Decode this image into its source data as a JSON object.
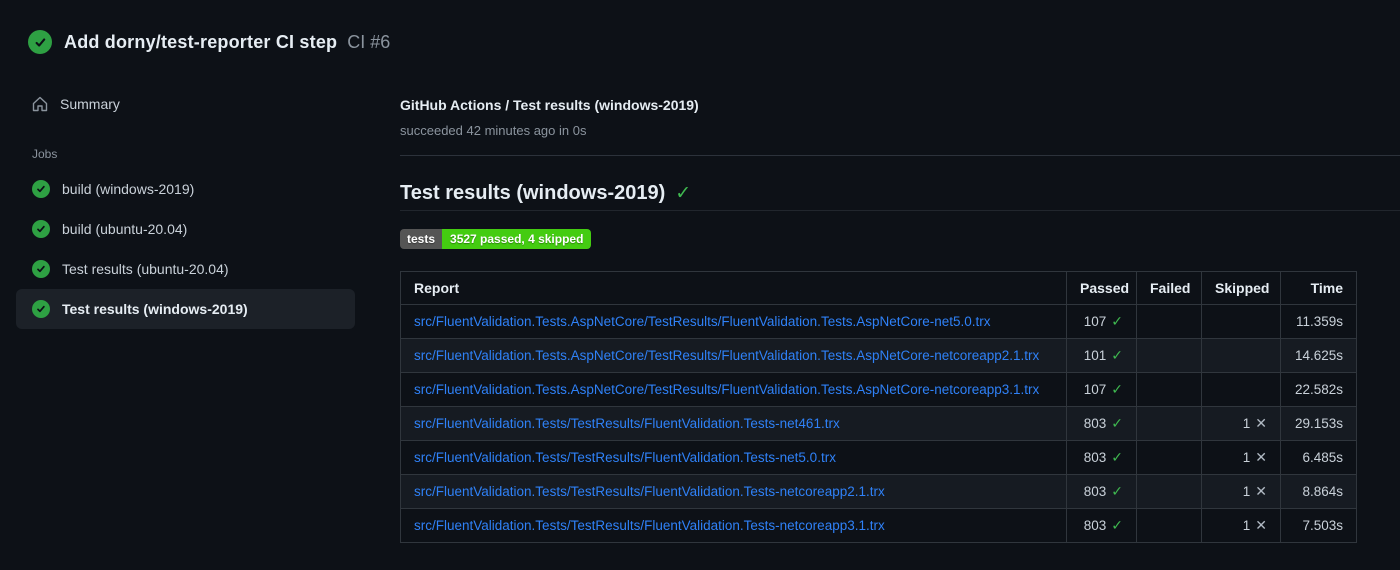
{
  "header": {
    "title": "Add dorny/test-reporter CI step",
    "run_number": "CI #6"
  },
  "sidebar": {
    "summary_label": "Summary",
    "jobs_section_label": "Jobs",
    "jobs": [
      {
        "label": "build (windows-2019)",
        "selected": false
      },
      {
        "label": "build (ubuntu-20.04)",
        "selected": false
      },
      {
        "label": "Test results (ubuntu-20.04)",
        "selected": false
      },
      {
        "label": "Test results (windows-2019)",
        "selected": true
      }
    ]
  },
  "main": {
    "check_title": "GitHub Actions / Test results (windows-2019)",
    "check_status": "succeeded 42 minutes ago in 0s",
    "section_title": "Test results (windows-2019)",
    "badge": {
      "label": "tests",
      "value": "3527 passed, 4 skipped",
      "label_bg": "#555555",
      "value_bg": "#44cc11"
    },
    "table": {
      "headers": [
        "Report",
        "Passed",
        "Failed",
        "Skipped",
        "Time"
      ],
      "rows": [
        {
          "report": "src/FluentValidation.Tests.AspNetCore/TestResults/FluentValidation.Tests.AspNetCore-net5.0.trx",
          "passed": "107",
          "failed": "",
          "skipped": "",
          "time": "11.359s"
        },
        {
          "report": "src/FluentValidation.Tests.AspNetCore/TestResults/FluentValidation.Tests.AspNetCore-netcoreapp2.1.trx",
          "passed": "101",
          "failed": "",
          "skipped": "",
          "time": "14.625s"
        },
        {
          "report": "src/FluentValidation.Tests.AspNetCore/TestResults/FluentValidation.Tests.AspNetCore-netcoreapp3.1.trx",
          "passed": "107",
          "failed": "",
          "skipped": "",
          "time": "22.582s"
        },
        {
          "report": "src/FluentValidation.Tests/TestResults/FluentValidation.Tests-net461.trx",
          "passed": "803",
          "failed": "",
          "skipped": "1",
          "time": "29.153s"
        },
        {
          "report": "src/FluentValidation.Tests/TestResults/FluentValidation.Tests-net5.0.trx",
          "passed": "803",
          "failed": "",
          "skipped": "1",
          "time": "6.485s"
        },
        {
          "report": "src/FluentValidation.Tests/TestResults/FluentValidation.Tests-netcoreapp2.1.trx",
          "passed": "803",
          "failed": "",
          "skipped": "1",
          "time": "8.864s"
        },
        {
          "report": "src/FluentValidation.Tests/TestResults/FluentValidation.Tests-netcoreapp3.1.trx",
          "passed": "803",
          "failed": "",
          "skipped": "1",
          "time": "7.503s"
        }
      ]
    }
  },
  "icons": {
    "passed_glyph": "✓",
    "skipped_glyph": "✕",
    "heading_check_glyph": "✓"
  },
  "colors": {
    "background": "#0d1117",
    "row_alt": "#161b22",
    "border": "#30363d",
    "link": "#2f81f7",
    "success_circle": "#2ea043",
    "success_check": "#3fb950",
    "text_primary": "#e6edf3",
    "text_secondary": "#8b949e"
  }
}
